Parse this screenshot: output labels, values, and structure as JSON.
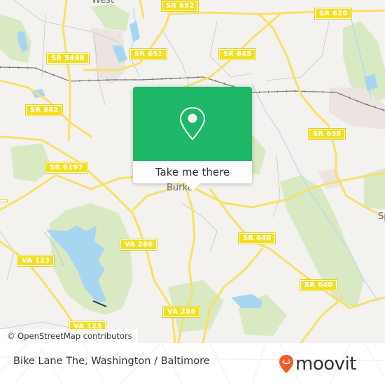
{
  "map": {
    "place_labels": [
      "West",
      "Burke",
      "Sp"
    ],
    "road_shields": [
      "SR 652",
      "SR 620",
      "SR 5498",
      "SR 651",
      "SR 645",
      "SR 643",
      "SR 638",
      "SR 6197",
      "SR 640",
      "SR 640",
      "VA 286",
      "VA 286",
      "VA 123",
      "VA 123"
    ],
    "colors": {
      "background": "#f3f2ee",
      "road": "#f7e06a",
      "park": "#d9e9c4",
      "water": "#a8d6f0",
      "shield": "#f2df1f"
    }
  },
  "popup": {
    "icon": "map-pin-icon",
    "button_label": "Take me there",
    "accent_color": "#1eb768"
  },
  "attribution": "© OpenStreetMap contributors",
  "footer": {
    "title": "Bike Lane The, Washington / Baltimore",
    "brand": "moovit",
    "brand_color": "#f15a29"
  }
}
